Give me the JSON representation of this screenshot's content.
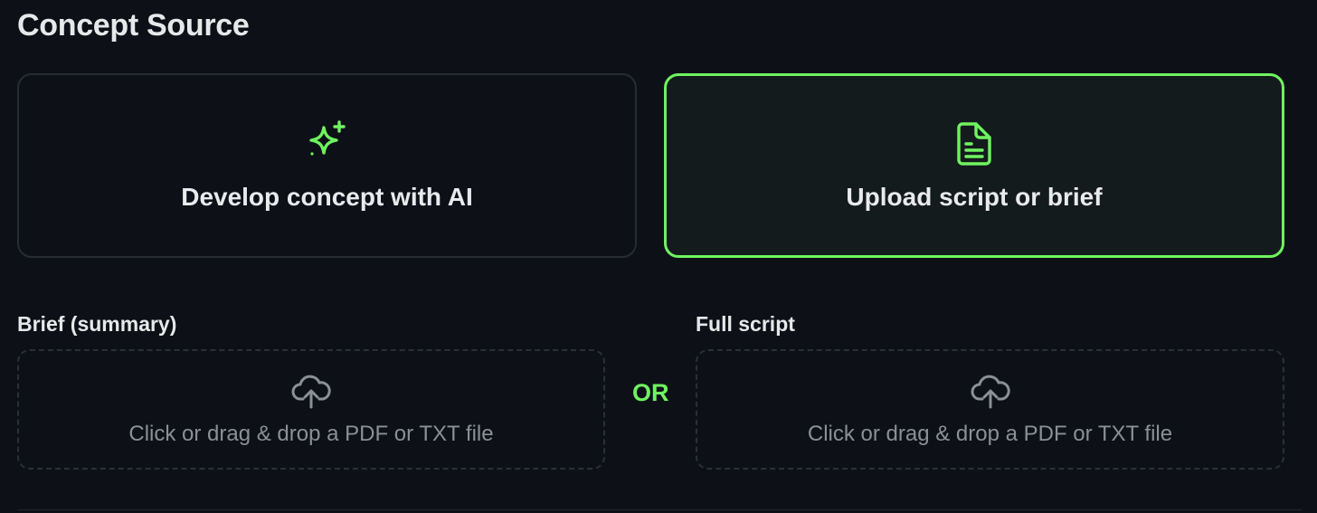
{
  "section": {
    "title": "Concept Source"
  },
  "options": {
    "develop_ai": {
      "label": "Develop concept with AI",
      "icon": "sparkles-icon",
      "selected": false
    },
    "upload": {
      "label": "Upload script or brief",
      "icon": "document-icon",
      "selected": true
    }
  },
  "brief": {
    "label": "Brief (summary)",
    "dropzone_hint": "Click or drag & drop a PDF or TXT file",
    "icon": "cloud-upload-icon"
  },
  "separator": {
    "text": "OR"
  },
  "full_script": {
    "label": "Full script",
    "dropzone_hint": "Click or drag & drop a PDF or TXT file",
    "icon": "cloud-upload-icon"
  },
  "colors": {
    "background": "#0d1117",
    "accent": "#6ff45f",
    "text": "#e6e8ea",
    "muted": "#8a8f98",
    "border": "#272b33"
  }
}
